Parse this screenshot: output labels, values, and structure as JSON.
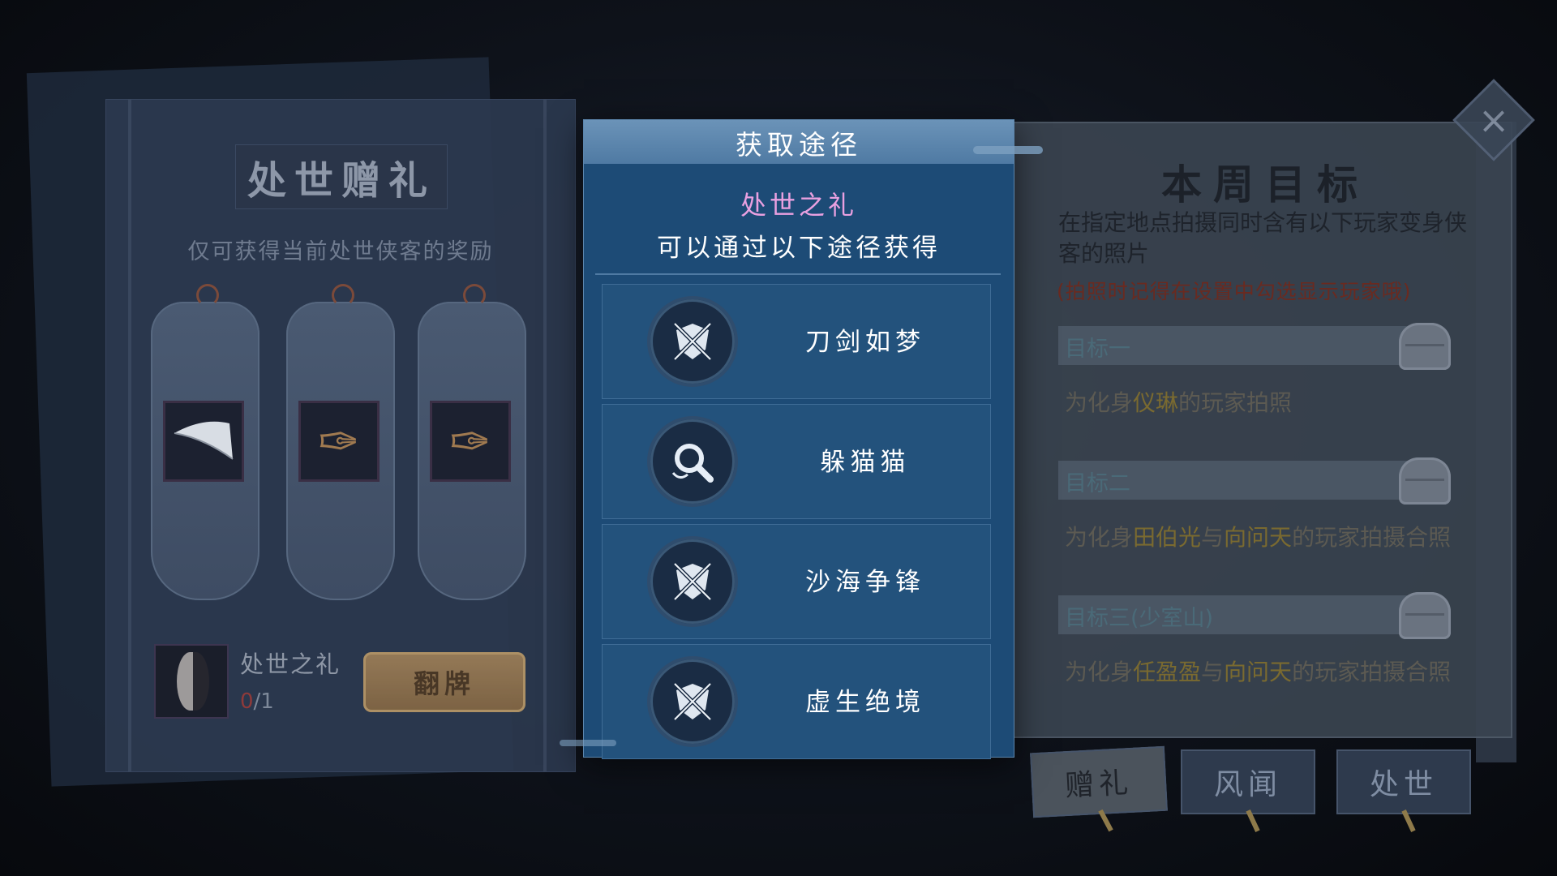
{
  "left_panel": {
    "title": "处世赠礼",
    "subtitle": "仅可获得当前处世侠客的奖励",
    "cards": [
      {
        "icon": "cloth-item-icon"
      },
      {
        "icon": "scroll-item-icon"
      },
      {
        "icon": "scroll-item-icon"
      }
    ],
    "gift_name": "处世之礼",
    "gift_count_current": "0",
    "gift_count_total": "/1",
    "flip_button": "翻牌"
  },
  "popup": {
    "title": "获取途径",
    "item_name": "处世之礼",
    "description": "可以通过以下途径获得",
    "sources": [
      {
        "name": "刀剑如梦",
        "icon": "crossed-swords-shield-icon"
      },
      {
        "name": "躲猫猫",
        "icon": "magnifier-icon"
      },
      {
        "name": "沙海争锋",
        "icon": "crossed-swords-shield-icon"
      },
      {
        "name": "虚生绝境",
        "icon": "crossed-swords-shield-icon"
      }
    ]
  },
  "right_panel": {
    "title": "本周目标",
    "description": "在指定地点拍摄同时含有以下玩家变身侠客的照片",
    "note": "(拍照时记得在设置中勾选显示玩家哦)",
    "goals": [
      {
        "label": "目标一",
        "text_prefix": "为化身",
        "highlight": "仪琳",
        "text_suffix": "的玩家拍照"
      },
      {
        "label": "目标二",
        "text_prefix": "为化身",
        "highlight": "田伯光",
        "mid": "与",
        "highlight2": "向问天",
        "text_suffix": "的玩家拍摄合照"
      },
      {
        "label": "目标三(少室山)",
        "text_prefix": "为化身",
        "highlight": "任盈盈",
        "mid": "与",
        "highlight2": "向问天",
        "text_suffix": "的玩家拍摄合照"
      }
    ],
    "tabs": [
      "赠礼",
      "风闻",
      "处世"
    ]
  },
  "close_icon": "×"
}
